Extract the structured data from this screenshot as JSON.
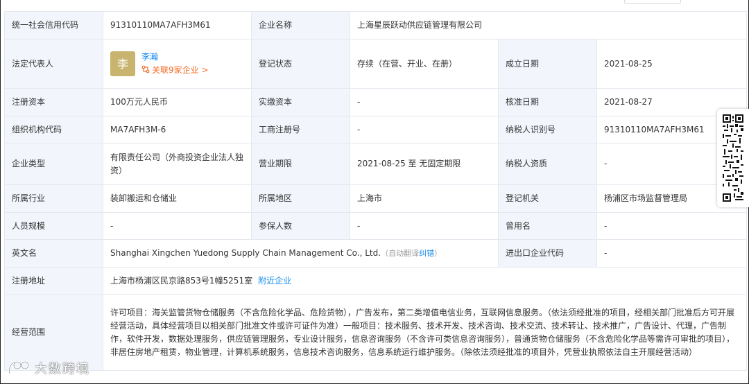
{
  "rows": {
    "credit_code": {
      "label": "统一社会信用代码",
      "value": "91310110MA7AFH3M61"
    },
    "company_name": {
      "label": "企业名称",
      "value": "上海星辰跃动供应链管理有限公司"
    },
    "legal_rep": {
      "label": "法定代表人",
      "avatar_char": "李",
      "name": "李瀚",
      "associated": "关联9家企业 >"
    },
    "reg_status": {
      "label": "登记状态",
      "value": "存续（在营、开业、在册）"
    },
    "established": {
      "label": "成立日期",
      "value": "2021-08-25"
    },
    "reg_capital": {
      "label": "注册资本",
      "value": "100万元人民币"
    },
    "paid_capital": {
      "label": "实缴资本",
      "value": "-"
    },
    "approved_date": {
      "label": "核准日期",
      "value": "2021-08-27"
    },
    "org_code": {
      "label": "组织机构代码",
      "value": "MA7AFH3M-6"
    },
    "biz_reg_no": {
      "label": "工商注册号",
      "value": "-"
    },
    "taxpayer_id": {
      "label": "纳税人识别号",
      "value": "91310110MA7AFH3M61"
    },
    "company_type": {
      "label": "企业类型",
      "value": "有限责任公司（外商投资企业法人独资）"
    },
    "biz_term": {
      "label": "营业期限",
      "value": "2021-08-25 至 无固定期限"
    },
    "taxpayer_qual": {
      "label": "纳税人资质",
      "value": "-"
    },
    "industry": {
      "label": "所属行业",
      "value": "装卸搬运和仓储业"
    },
    "region": {
      "label": "所属地区",
      "value": "上海市"
    },
    "reg_authority": {
      "label": "登记机关",
      "value": "杨浦区市场监督管理局"
    },
    "staff_size": {
      "label": "人员规模",
      "value": "-"
    },
    "insured": {
      "label": "参保人数",
      "value": "-"
    },
    "former_name": {
      "label": "曾用名",
      "value": "-"
    },
    "english_name": {
      "label": "英文名",
      "value": "Shanghai Xingchen Yuedong Supply Chain Management Co., Ltd.",
      "auto_translate": "（自动翻译",
      "correct": "纠错",
      "close_paren": "）"
    },
    "import_export": {
      "label": "进出口企业代码",
      "value": "-"
    },
    "address": {
      "label": "注册地址",
      "value": "上海市杨浦区民京路853号1幢5251室",
      "nearby": "附近企业"
    },
    "scope": {
      "label": "经营范围",
      "value": "许可项目：海关监管货物仓储服务（不含危险化学品、危险货物），广告发布，第二类增值电信业务，互联网信息服务。（依法须经批准的项目，经相关部门批准后方可开展经营活动，具体经营项目以相关部门批准文件或许可证件为准）一般项目：技术服务、技术开发、技术咨询、技术交流、技术转让、技术推广，广告设计、代理，广告制作，软件开发，数据处理服务，供应链管理服务，专业设计服务，信息咨询服务（不含许可类信息咨询服务），普通货物仓储服务（不含危险化学品等需许可审批的项目），非居住房地产租赁，物业管理，计算机系统服务，信息技术咨询服务，信息系统运行维护服务。（除依法须经批准的项目外，凭营业执照依法自主开展经营活动）"
    }
  },
  "watermark": "大数跨境",
  "colors": {
    "label_bg": "#f2f6fc",
    "link": "#128bed",
    "accent_orange": "#f46d2a",
    "avatar_bg": "#c8b46e",
    "border": "#e4e8ef"
  }
}
